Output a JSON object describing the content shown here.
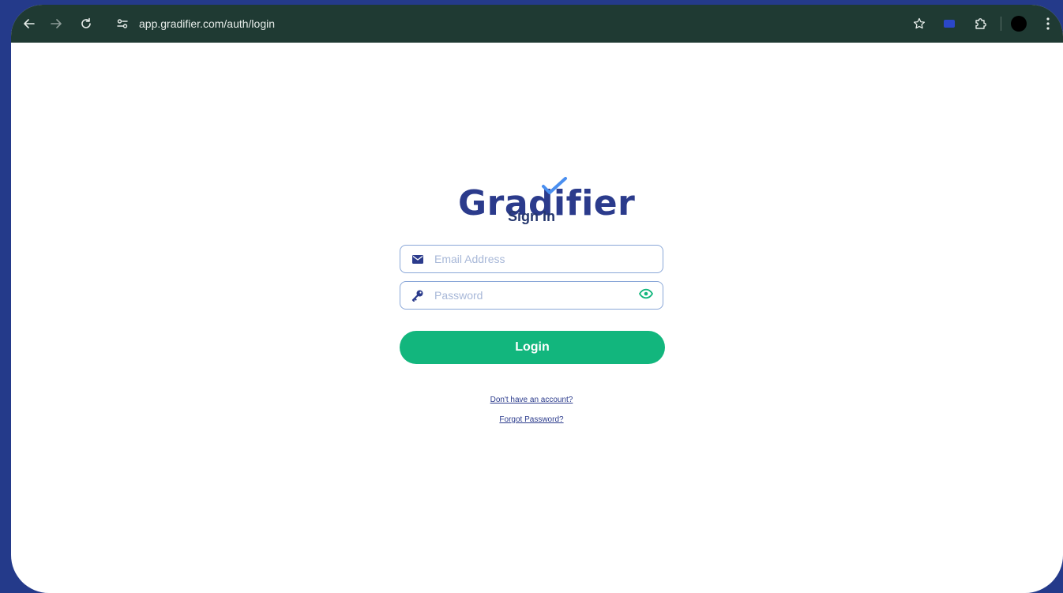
{
  "browser": {
    "url": "app.gradifier.com/auth/login"
  },
  "logo": {
    "text": "Gradifier"
  },
  "form": {
    "title": "Sign In",
    "email_placeholder": "Email Address",
    "password_placeholder": "Password",
    "login_label": "Login",
    "signup_link": "Don't have an account?",
    "forgot_link": "Forgot Password?"
  },
  "colors": {
    "brand_blue": "#2b3b8c",
    "accent_green": "#12b67d",
    "browser_bar": "#1f3a33",
    "desktop_bg": "#243a8a"
  },
  "icons": {
    "email": "envelope-icon",
    "password": "key-icon",
    "toggle": "eye-icon"
  }
}
